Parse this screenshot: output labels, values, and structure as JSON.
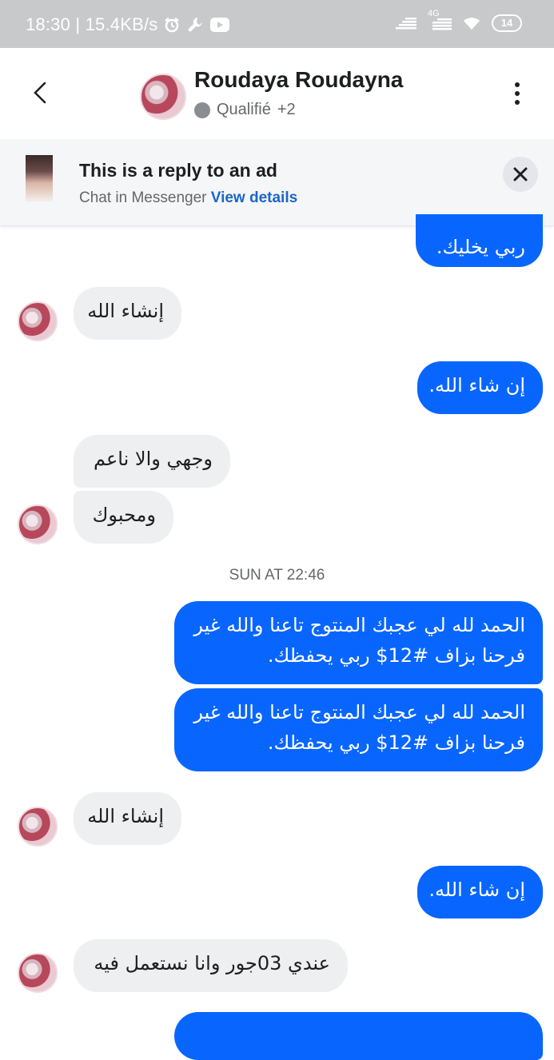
{
  "status_bar": {
    "time_speed": "18:30 | 15.4KB/s",
    "network": "4G",
    "battery": "14"
  },
  "header": {
    "contact_name": "Roudaya Roudayna",
    "status_label": "Qualifié",
    "extra_count": "+2"
  },
  "ad_banner": {
    "title": "This is a reply to an ad",
    "subtitle": "Chat in Messenger",
    "link": "View details"
  },
  "messages": [
    {
      "dir": "out",
      "text": "ربي يخليك."
    },
    {
      "dir": "in",
      "text": "إنشاء الله"
    },
    {
      "dir": "out",
      "text": "إن شاء الله."
    },
    {
      "dir": "in",
      "text": "وجهي والا ناعم"
    },
    {
      "dir": "in",
      "text": "ومحبوك"
    },
    {
      "dir": "out",
      "text": "الحمد لله لي عجبك المنتوج تاعنا والله غير\nفرحنا بزاف #12$ ربي يحفظك."
    },
    {
      "dir": "out",
      "text": "الحمد لله لي عجبك المنتوج تاعنا والله غير\nفرحنا بزاف #12$ ربي يحفظك."
    },
    {
      "dir": "in",
      "text": "إنشاء الله"
    },
    {
      "dir": "out",
      "text": "إن شاء الله."
    },
    {
      "dir": "in",
      "text": "عندي 03جور وانا نستعمل فيه"
    }
  ],
  "timestamp": "SUN AT 22:46",
  "colors": {
    "outgoing": "#0866ff",
    "incoming": "#eeeff1",
    "link": "#1b66c9"
  }
}
